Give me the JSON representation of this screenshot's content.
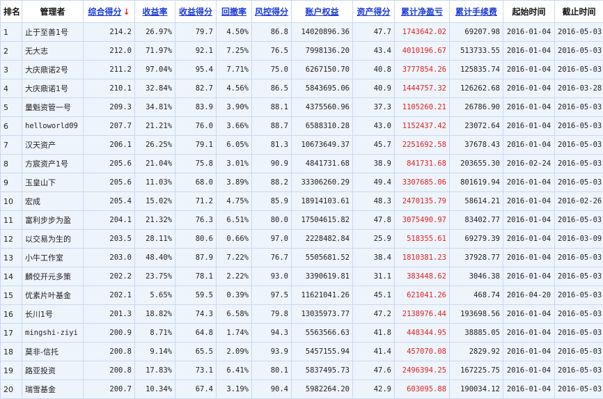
{
  "columns": {
    "rank": "排名",
    "manager": "管理者",
    "total_score": "综合得分",
    "sort_indicator": "↓",
    "return_rate": "收益率",
    "return_score": "收益得分",
    "drawdown": "回撤率",
    "risk_score": "风控得分",
    "equity": "账户权益",
    "asset_score": "资产得分",
    "cum_pnl": "累计净盈亏",
    "cum_fee": "累计手续费",
    "start_time": "起始时间",
    "end_time": "截止时间"
  },
  "rows": [
    {
      "rank": "1",
      "manager": "止于至善1号",
      "total_score": "214.2",
      "return_rate": "26.97%",
      "return_score": "79.7",
      "drawdown": "4.50%",
      "risk_score": "86.8",
      "equity": "14020896.36",
      "asset_score": "47.7",
      "cum_pnl": "1743642.02",
      "cum_fee": "69207.98",
      "start_time": "2016-01-04",
      "end_time": "2016-05-03"
    },
    {
      "rank": "2",
      "manager": "无大志",
      "total_score": "212.0",
      "return_rate": "71.97%",
      "return_score": "92.1",
      "drawdown": "7.25%",
      "risk_score": "76.5",
      "equity": "7998136.20",
      "asset_score": "43.4",
      "cum_pnl": "4010196.67",
      "cum_fee": "513733.55",
      "start_time": "2016-01-04",
      "end_time": "2016-05-03"
    },
    {
      "rank": "3",
      "manager": "大庆鼎诺2号",
      "total_score": "211.2",
      "return_rate": "97.04%",
      "return_score": "95.4",
      "drawdown": "7.71%",
      "risk_score": "75.0",
      "equity": "6267150.70",
      "asset_score": "40.8",
      "cum_pnl": "3777854.26",
      "cum_fee": "125835.74",
      "start_time": "2016-01-04",
      "end_time": "2016-05-03"
    },
    {
      "rank": "4",
      "manager": "大庆鼎诺1号",
      "total_score": "210.1",
      "return_rate": "32.84%",
      "return_score": "82.7",
      "drawdown": "4.56%",
      "risk_score": "86.5",
      "equity": "5843695.06",
      "asset_score": "40.9",
      "cum_pnl": "1444757.32",
      "cum_fee": "126262.68",
      "start_time": "2016-01-04",
      "end_time": "2016-03-28"
    },
    {
      "rank": "5",
      "manager": "量魁资管一号",
      "total_score": "209.3",
      "return_rate": "34.81%",
      "return_score": "83.9",
      "drawdown": "3.90%",
      "risk_score": "88.1",
      "equity": "4375560.96",
      "asset_score": "37.3",
      "cum_pnl": "1105260.21",
      "cum_fee": "26786.90",
      "start_time": "2016-01-04",
      "end_time": "2016-05-03"
    },
    {
      "rank": "6",
      "manager": "helloworld09",
      "total_score": "207.7",
      "return_rate": "21.21%",
      "return_score": "76.0",
      "drawdown": "3.66%",
      "risk_score": "88.7",
      "equity": "6588310.28",
      "asset_score": "43.0",
      "cum_pnl": "1152437.42",
      "cum_fee": "23072.64",
      "start_time": "2016-01-04",
      "end_time": "2016-05-03"
    },
    {
      "rank": "7",
      "manager": "汉天资产",
      "total_score": "206.1",
      "return_rate": "26.25%",
      "return_score": "79.1",
      "drawdown": "6.05%",
      "risk_score": "81.3",
      "equity": "10673649.37",
      "asset_score": "45.7",
      "cum_pnl": "2251692.58",
      "cum_fee": "37678.43",
      "start_time": "2016-01-04",
      "end_time": "2016-05-03"
    },
    {
      "rank": "8",
      "manager": "方宸资产1号",
      "total_score": "205.6",
      "return_rate": "21.04%",
      "return_score": "75.8",
      "drawdown": "3.01%",
      "risk_score": "90.9",
      "equity": "4841731.68",
      "asset_score": "38.9",
      "cum_pnl": "841731.68",
      "cum_fee": "203655.30",
      "start_time": "2016-02-24",
      "end_time": "2016-05-03"
    },
    {
      "rank": "9",
      "manager": "玉皇山下",
      "total_score": "205.6",
      "return_rate": "11.03%",
      "return_score": "68.0",
      "drawdown": "3.89%",
      "risk_score": "88.2",
      "equity": "33306260.29",
      "asset_score": "49.4",
      "cum_pnl": "3307685.06",
      "cum_fee": "801619.94",
      "start_time": "2016-01-04",
      "end_time": "2016-05-03"
    },
    {
      "rank": "10",
      "manager": "宏成",
      "total_score": "205.4",
      "return_rate": "15.02%",
      "return_score": "71.2",
      "drawdown": "4.75%",
      "risk_score": "85.9",
      "equity": "18914103.61",
      "asset_score": "48.3",
      "cum_pnl": "2470135.79",
      "cum_fee": "58614.21",
      "start_time": "2016-01-04",
      "end_time": "2016-02-26"
    },
    {
      "rank": "11",
      "manager": "富利步步为盈",
      "total_score": "204.1",
      "return_rate": "21.32%",
      "return_score": "76.3",
      "drawdown": "6.51%",
      "risk_score": "80.0",
      "equity": "17504615.82",
      "asset_score": "47.8",
      "cum_pnl": "3075490.97",
      "cum_fee": "83402.77",
      "start_time": "2016-01-04",
      "end_time": "2016-05-03"
    },
    {
      "rank": "12",
      "manager": "以交易为生的",
      "total_score": "203.5",
      "return_rate": "28.11%",
      "return_score": "80.6",
      "drawdown": "0.66%",
      "risk_score": "97.0",
      "equity": "2228482.84",
      "asset_score": "25.9",
      "cum_pnl": "518355.61",
      "cum_fee": "69279.39",
      "start_time": "2016-01-04",
      "end_time": "2016-03-09"
    },
    {
      "rank": "13",
      "manager": "小牛工作室",
      "total_score": "203.0",
      "return_rate": "48.40%",
      "return_score": "87.9",
      "drawdown": "7.22%",
      "risk_score": "76.7",
      "equity": "5505681.52",
      "asset_score": "38.4",
      "cum_pnl": "1810381.23",
      "cum_fee": "37928.77",
      "start_time": "2016-01-04",
      "end_time": "2016-05-03"
    },
    {
      "rank": "14",
      "manager": "麟佼开元多策",
      "total_score": "202.2",
      "return_rate": "23.75%",
      "return_score": "78.1",
      "drawdown": "2.22%",
      "risk_score": "93.0",
      "equity": "3390619.81",
      "asset_score": "31.1",
      "cum_pnl": "383448.62",
      "cum_fee": "3046.38",
      "start_time": "2016-01-04",
      "end_time": "2016-05-03"
    },
    {
      "rank": "15",
      "manager": "优素片叶基金",
      "total_score": "202.1",
      "return_rate": "5.65%",
      "return_score": "59.5",
      "drawdown": "0.39%",
      "risk_score": "97.5",
      "equity": "11621041.26",
      "asset_score": "45.1",
      "cum_pnl": "621041.26",
      "cum_fee": "468.74",
      "start_time": "2016-04-20",
      "end_time": "2016-05-03"
    },
    {
      "rank": "16",
      "manager": "长川1号",
      "total_score": "201.3",
      "return_rate": "18.82%",
      "return_score": "74.3",
      "drawdown": "6.58%",
      "risk_score": "79.8",
      "equity": "13035973.77",
      "asset_score": "47.2",
      "cum_pnl": "2138976.44",
      "cum_fee": "193698.56",
      "start_time": "2016-01-04",
      "end_time": "2016-05-03"
    },
    {
      "rank": "17",
      "manager": "mingshi-ziyi",
      "total_score": "200.9",
      "return_rate": "8.71%",
      "return_score": "64.8",
      "drawdown": "1.74%",
      "risk_score": "94.3",
      "equity": "5563566.63",
      "asset_score": "41.8",
      "cum_pnl": "448344.95",
      "cum_fee": "38885.05",
      "start_time": "2016-01-04",
      "end_time": "2016-05-03"
    },
    {
      "rank": "18",
      "manager": "莫非-信托",
      "total_score": "200.8",
      "return_rate": "9.14%",
      "return_score": "65.5",
      "drawdown": "2.09%",
      "risk_score": "93.9",
      "equity": "5457155.94",
      "asset_score": "41.4",
      "cum_pnl": "457070.08",
      "cum_fee": "2829.92",
      "start_time": "2016-01-04",
      "end_time": "2016-05-03"
    },
    {
      "rank": "19",
      "manager": "路亚投资",
      "total_score": "200.8",
      "return_rate": "17.83%",
      "return_score": "73.1",
      "drawdown": "6.41%",
      "risk_score": "80.1",
      "equity": "5837495.73",
      "asset_score": "47.6",
      "cum_pnl": "2496394.25",
      "cum_fee": "167225.75",
      "start_time": "2016-01-04",
      "end_time": "2016-05-03"
    },
    {
      "rank": "20",
      "manager": "瑞雪基金",
      "total_score": "200.7",
      "return_rate": "10.34%",
      "return_score": "67.4",
      "drawdown": "3.19%",
      "risk_score": "90.4",
      "equity": "5982264.20",
      "asset_score": "42.9",
      "cum_pnl": "603095.88",
      "cum_fee": "190034.12",
      "start_time": "2016-01-04",
      "end_time": "2016-05-03"
    }
  ],
  "colors": {
    "link": "#1b39d9",
    "profit": "#e02020",
    "row_bg": "#eef4fc",
    "border": "#c9d9ee"
  }
}
